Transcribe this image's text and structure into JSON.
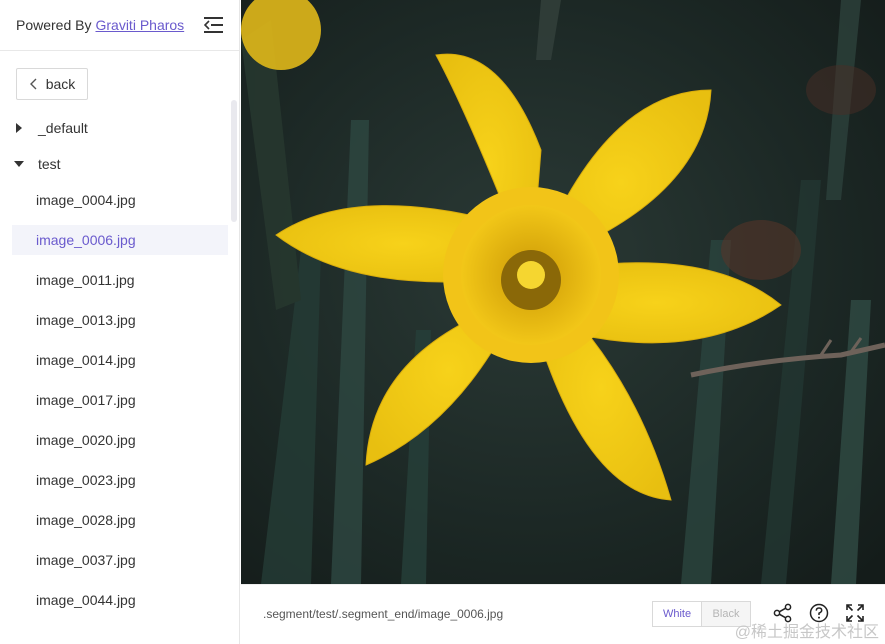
{
  "sidebar": {
    "powered_by": "Powered By",
    "brand_link": "Graviti Pharos",
    "back_label": "back",
    "folders": [
      {
        "name": "_default",
        "expanded": false
      },
      {
        "name": "test",
        "expanded": true
      }
    ],
    "files": [
      "image_0004.jpg",
      "image_0006.jpg",
      "image_0011.jpg",
      "image_0013.jpg",
      "image_0014.jpg",
      "image_0017.jpg",
      "image_0020.jpg",
      "image_0023.jpg",
      "image_0028.jpg",
      "image_0037.jpg",
      "image_0044.jpg"
    ],
    "selected_file": "image_0006.jpg"
  },
  "viewer": {
    "image_subject": "yellow daffodil flower"
  },
  "bottombar": {
    "path": ".segment/test/.segment_end/image_0006.jpg",
    "bg_white": "White",
    "bg_black": "Black",
    "watermark": "@稀土掘金技术社区"
  },
  "colors": {
    "accent": "#6a5acd",
    "selected_bg": "#f3f4fa"
  },
  "icons": [
    "menu-collapse-icon",
    "chevron-left-icon",
    "caret-right-icon",
    "caret-down-icon",
    "share-icon",
    "help-icon",
    "fullscreen-icon"
  ]
}
